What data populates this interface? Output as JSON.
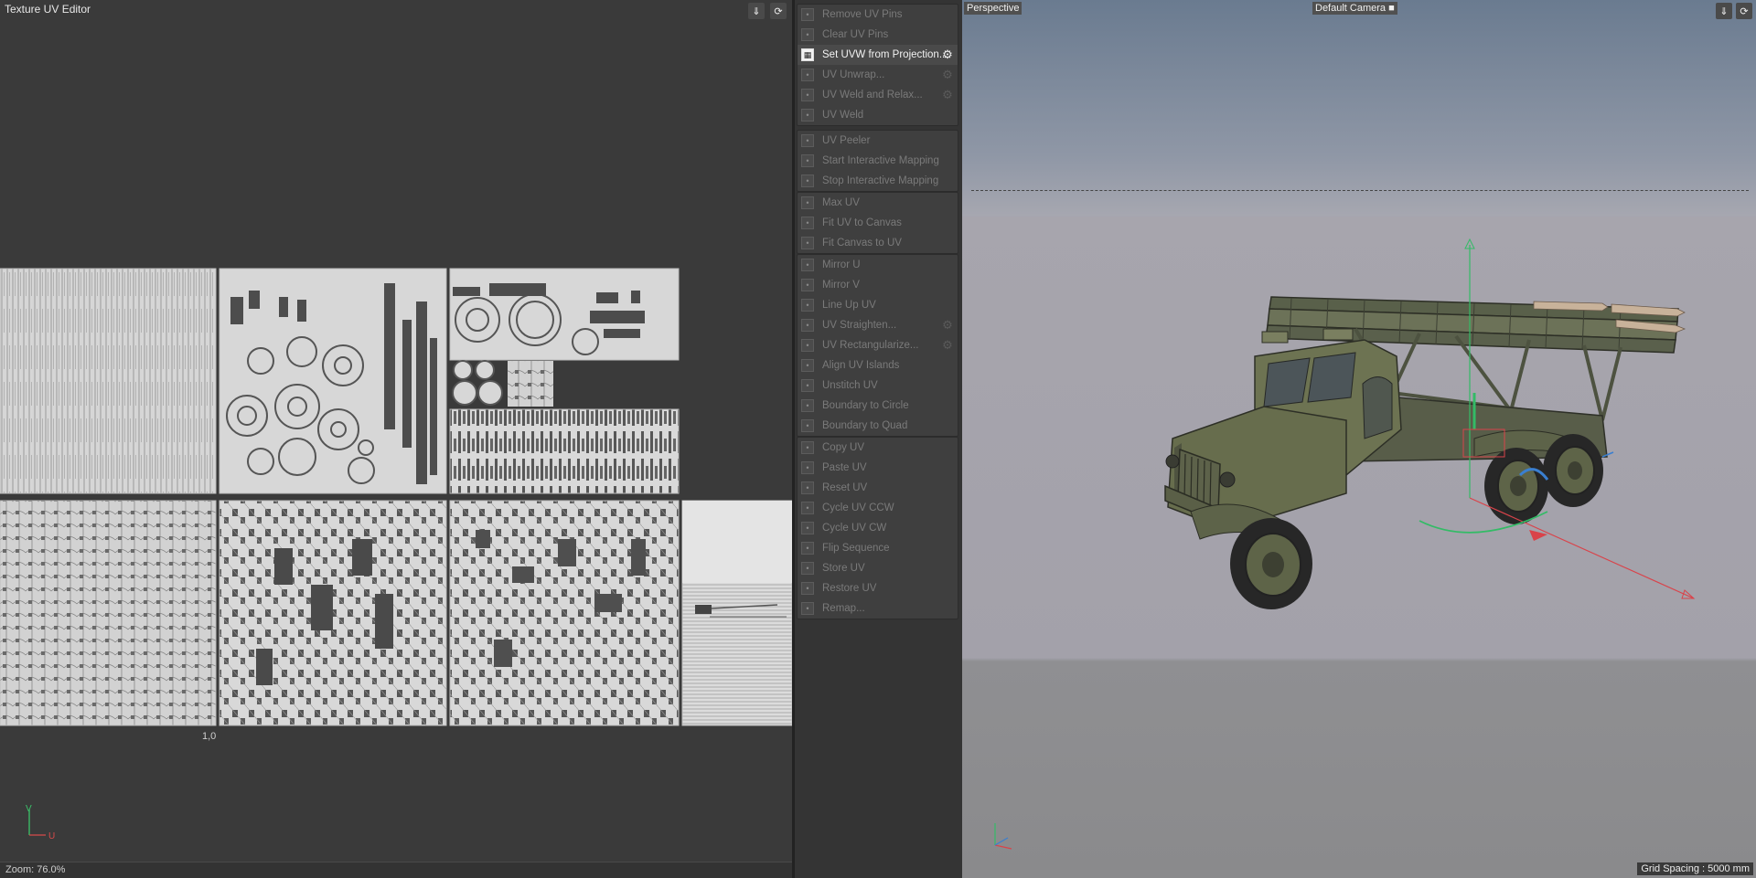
{
  "uv_editor": {
    "title": "Texture UV Editor",
    "origin_label": "1,0",
    "axis_v": "V",
    "axis_u": "U",
    "zoom_text": "Zoom: 76.0%"
  },
  "uv_panel": {
    "groups": [
      {
        "items": [
          {
            "label": "Remove UV Pins",
            "icon": "pin-remove-icon",
            "enabled": false
          },
          {
            "label": "Clear UV Pins",
            "icon": "pin-clear-icon",
            "enabled": false
          },
          {
            "label": "Set UVW from Projection...",
            "icon": "checker-icon",
            "enabled": true,
            "gear": true,
            "active": true
          },
          {
            "label": "UV Unwrap...",
            "icon": "unwrap-icon",
            "enabled": false,
            "gear": true
          },
          {
            "label": "UV Weld and Relax...",
            "icon": "weld-relax-icon",
            "enabled": false,
            "gear": true
          },
          {
            "label": "UV Weld",
            "icon": "weld-icon",
            "enabled": false
          }
        ]
      },
      {
        "items": [
          {
            "label": "UV Peeler",
            "icon": "peeler-icon",
            "enabled": false
          },
          {
            "label": "Start Interactive Mapping",
            "icon": "interactive-start-icon",
            "enabled": false
          },
          {
            "label": "Stop Interactive Mapping",
            "icon": "interactive-stop-icon",
            "enabled": false
          }
        ]
      },
      {
        "items": [
          {
            "label": "Max UV",
            "icon": "max-uv-icon",
            "enabled": false
          },
          {
            "label": "Fit UV to Canvas",
            "icon": "fit-uv-icon",
            "enabled": false
          },
          {
            "label": "Fit Canvas to UV",
            "icon": "fit-canvas-icon",
            "enabled": false
          }
        ]
      },
      {
        "items": [
          {
            "label": "Mirror U",
            "icon": "mirror-u-icon",
            "enabled": false
          },
          {
            "label": "Mirror V",
            "icon": "mirror-v-icon",
            "enabled": false
          },
          {
            "label": "Line Up UV",
            "icon": "line-up-icon",
            "enabled": false
          },
          {
            "label": "UV Straighten...",
            "icon": "straighten-icon",
            "enabled": false,
            "gear": true
          },
          {
            "label": "UV Rectangularize...",
            "icon": "rectangularize-icon",
            "enabled": false,
            "gear": true
          },
          {
            "label": "Align UV Islands",
            "icon": "align-icon",
            "enabled": false
          },
          {
            "label": "Unstitch UV",
            "icon": "unstitch-icon",
            "enabled": false
          },
          {
            "label": "Boundary to Circle",
            "icon": "boundary-circle-icon",
            "enabled": false
          },
          {
            "label": "Boundary to Quad",
            "icon": "boundary-quad-icon",
            "enabled": false
          }
        ]
      },
      {
        "items": [
          {
            "label": "Copy UV",
            "icon": "copy-icon",
            "enabled": false
          },
          {
            "label": "Paste UV",
            "icon": "paste-icon",
            "enabled": false
          },
          {
            "label": "Reset UV",
            "icon": "reset-icon",
            "enabled": false
          },
          {
            "label": "Cycle UV CCW",
            "icon": "cycle-ccw-icon",
            "enabled": false
          },
          {
            "label": "Cycle UV CW",
            "icon": "cycle-cw-icon",
            "enabled": false
          },
          {
            "label": "Flip Sequence",
            "icon": "flip-icon",
            "enabled": false
          },
          {
            "label": "Store UV",
            "icon": "store-icon",
            "enabled": false
          },
          {
            "label": "Restore UV",
            "icon": "restore-icon",
            "enabled": false
          },
          {
            "label": "Remap...",
            "icon": "remap-icon",
            "enabled": false
          }
        ]
      }
    ]
  },
  "viewport": {
    "view_label": "Perspective",
    "camera_label": "Default Camera",
    "grid_spacing": "Grid Spacing : 5000 mm"
  },
  "colors": {
    "panel_bg": "#3a3a3a",
    "uv_island": "#d8d8d8",
    "truck_green": "#6b7050",
    "axis_x": "#d9434a",
    "axis_y": "#33bb66",
    "axis_z": "#3a7fd0"
  }
}
